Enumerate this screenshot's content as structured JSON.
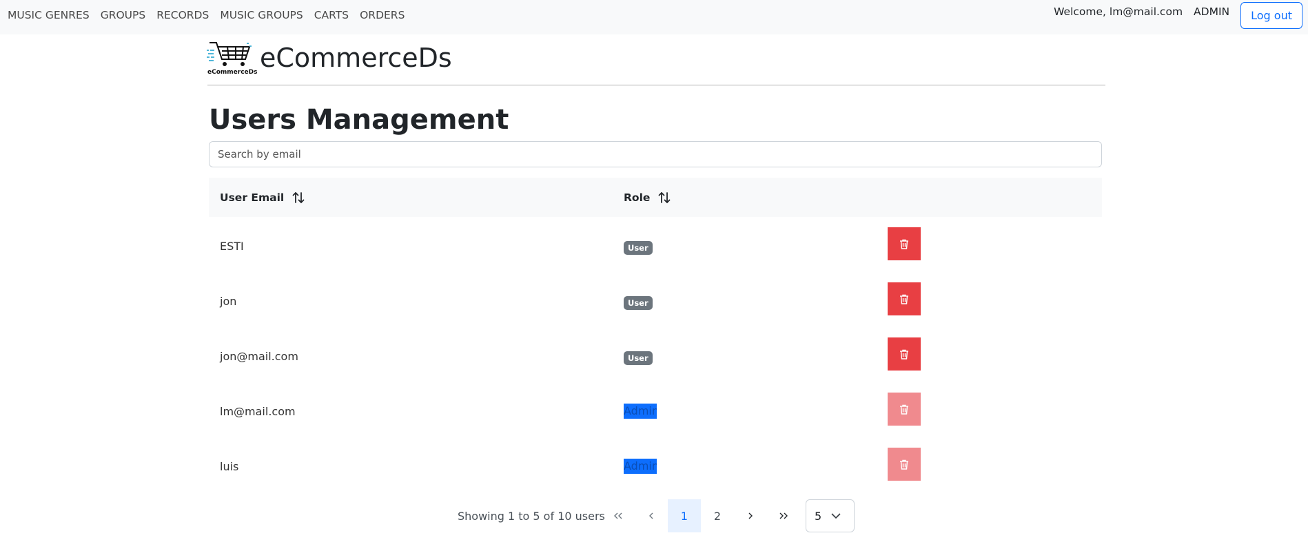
{
  "nav": {
    "links": [
      "MUSIC GENRES",
      "GROUPS",
      "RECORDS",
      "MUSIC GROUPS",
      "CARTS",
      "ORDERS"
    ],
    "welcome": "Welcome, lm@mail.com",
    "role": "ADMIN",
    "logout_label": "Log out"
  },
  "brand": {
    "logo_text": "eCommerceDs",
    "name": "eCommerceDs"
  },
  "page": {
    "title": "Users Management",
    "search_placeholder": "Search by email"
  },
  "table": {
    "columns": [
      "User Email",
      "Role"
    ],
    "rows": [
      {
        "email": "ESTI",
        "role": "User",
        "delete_enabled": true
      },
      {
        "email": "jon",
        "role": "User",
        "delete_enabled": true
      },
      {
        "email": "jon@mail.com",
        "role": "User",
        "delete_enabled": true
      },
      {
        "email": "lm@mail.com",
        "role": "Admin",
        "delete_enabled": false
      },
      {
        "email": "luis",
        "role": "Admin",
        "delete_enabled": false
      }
    ]
  },
  "pagination": {
    "showing": "Showing 1 to 5 of 10 users",
    "first": "«",
    "prev": "‹",
    "pages": [
      "1",
      "2"
    ],
    "current_page": "1",
    "next": "›",
    "last": "»",
    "per_page": "5"
  },
  "colors": {
    "danger": "#dc3545",
    "primary": "#0d6efd",
    "badge_user": "#6c757d"
  }
}
